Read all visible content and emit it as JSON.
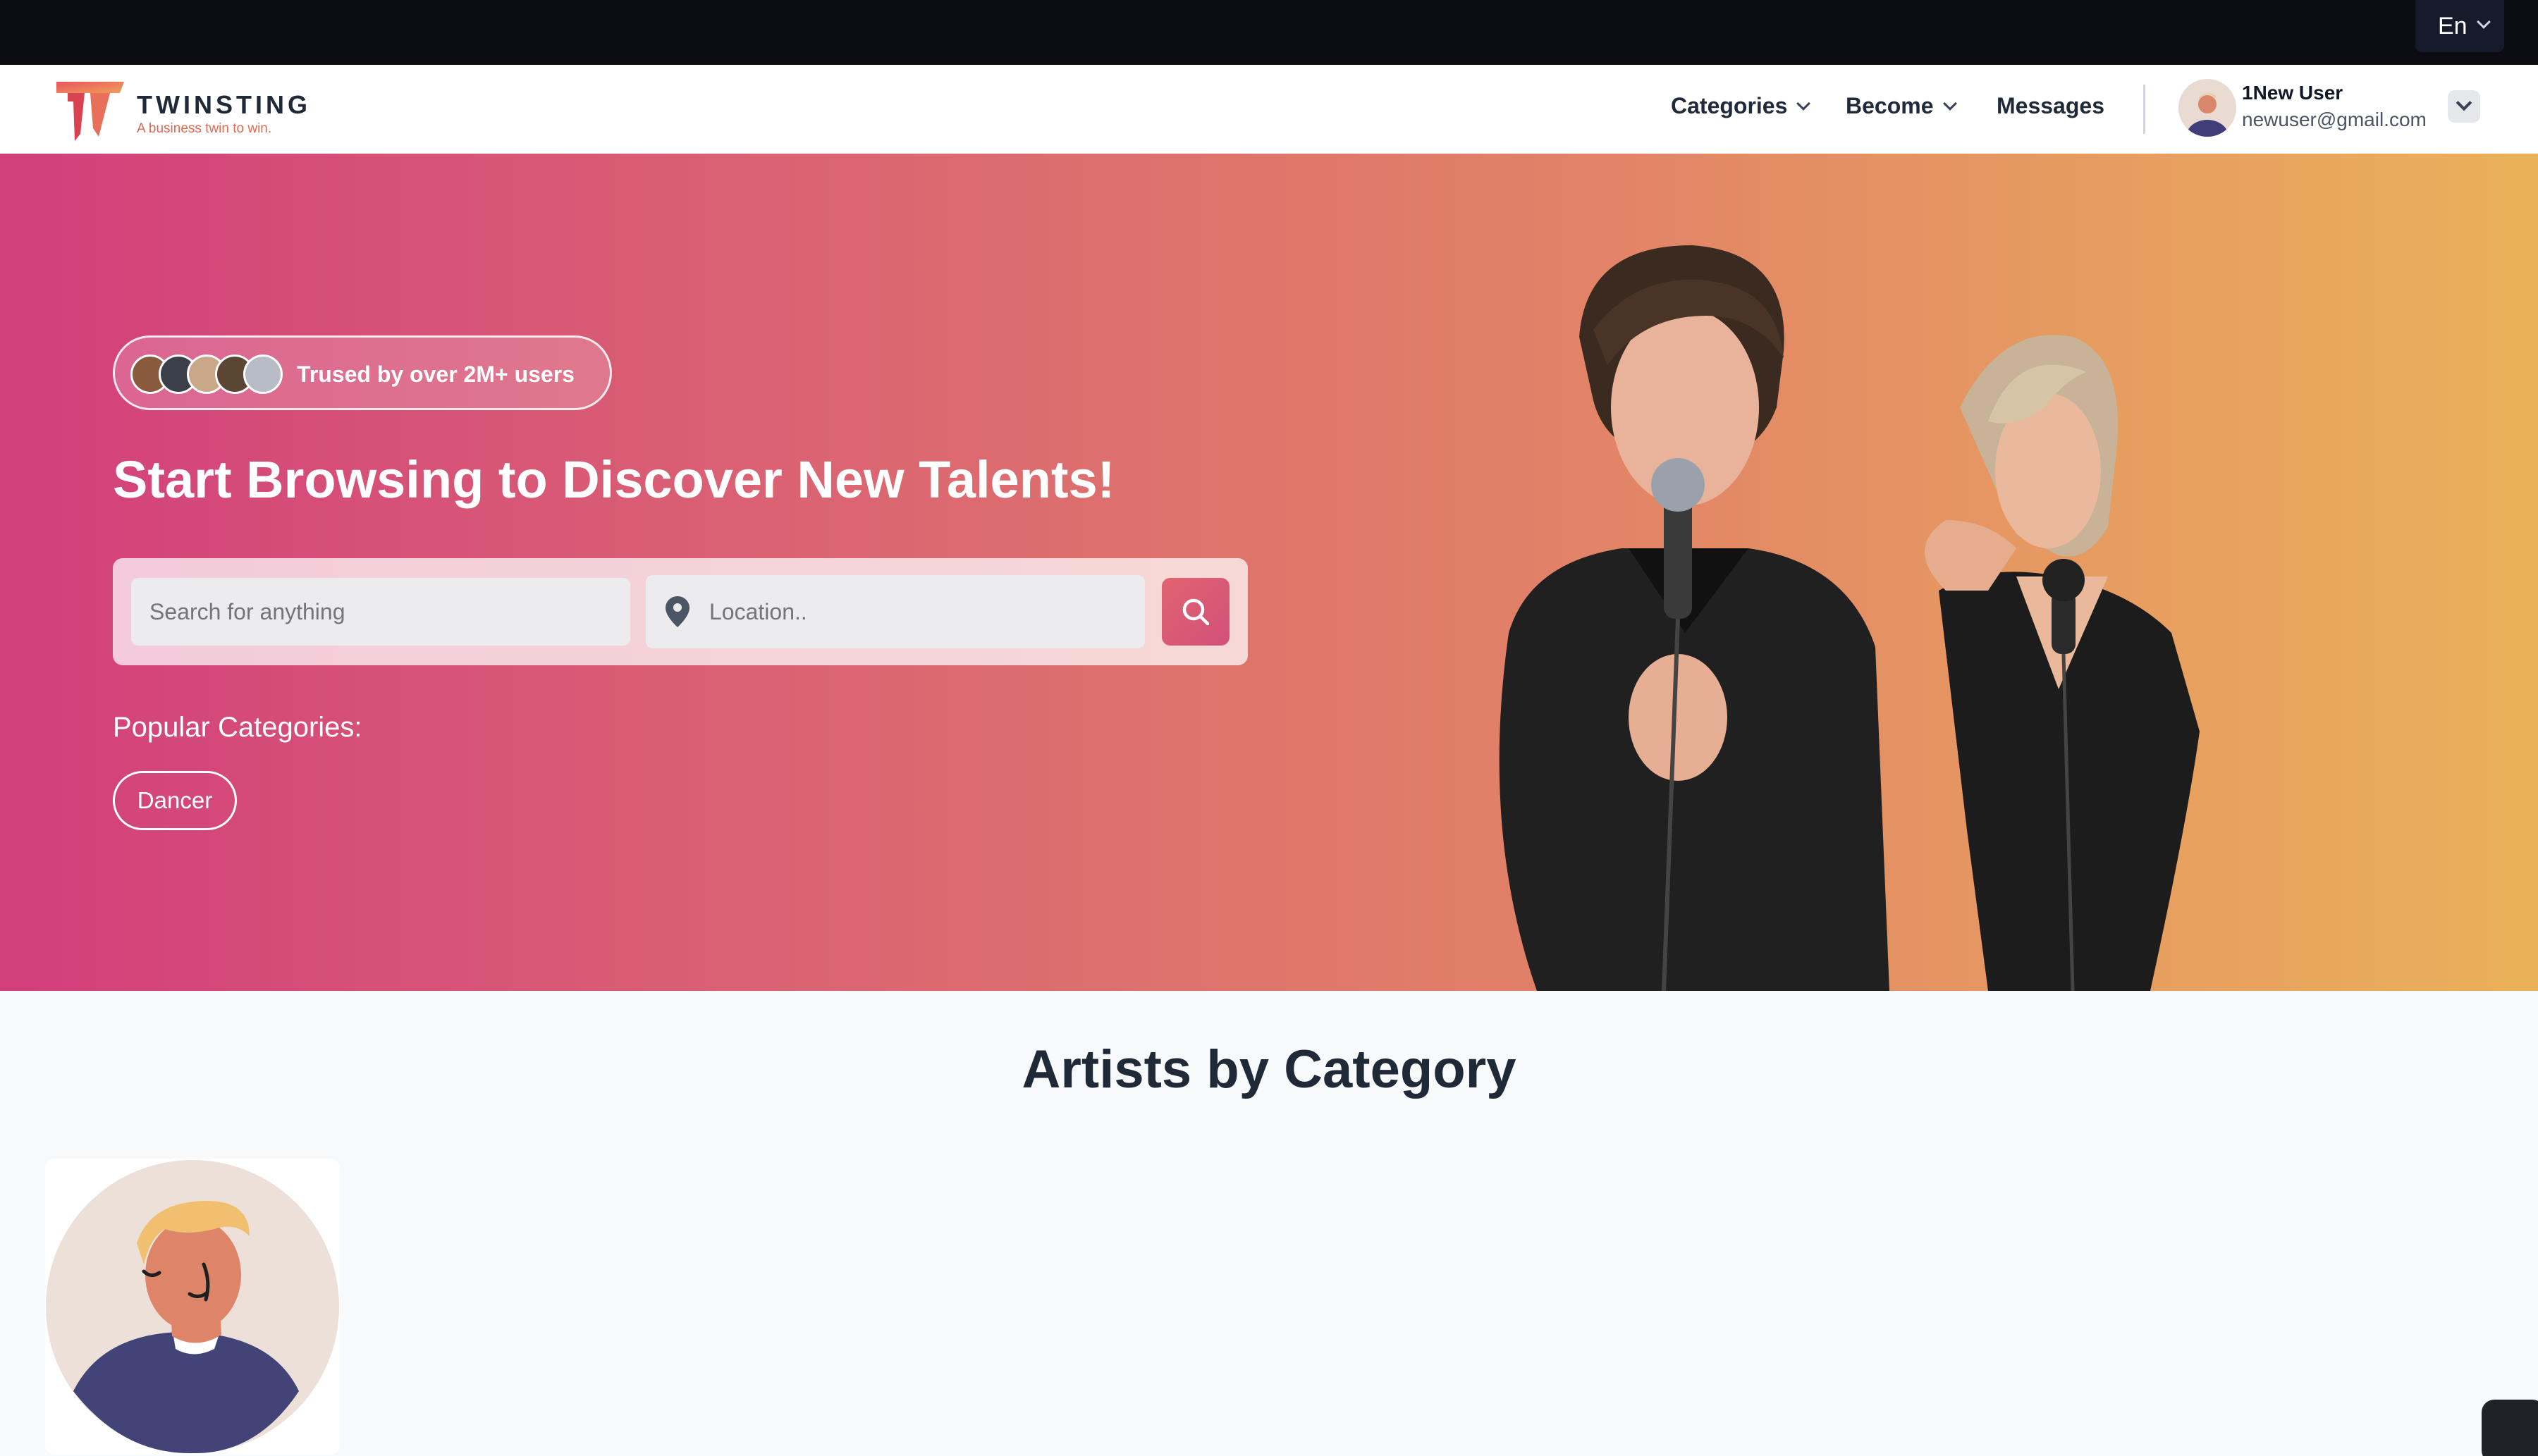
{
  "topbar": {
    "language": "En"
  },
  "navbar": {
    "brand_name": "TWINSTING",
    "brand_tagline": "A business twin to win.",
    "menu": {
      "categories": "Categories",
      "become": "Become",
      "messages": "Messages"
    },
    "user": {
      "name": "1New User",
      "email": "newuser@gmail.com"
    }
  },
  "hero": {
    "trust_text": "Trused by over 2M+ users",
    "title": "Start Browsing to Discover New Talents!",
    "search_placeholder": "Search for anything",
    "location_placeholder": "Location..",
    "popular_label": "Popular Categories:",
    "popular_categories": [
      "Dancer"
    ]
  },
  "section": {
    "title": "Artists by Category"
  },
  "colors": {
    "hero_start": "#d23f7b",
    "hero_end": "#ebb15a",
    "accent": "#e0646f",
    "dark": "#0c0d12"
  },
  "icons": [
    "chevron-down-icon",
    "location-pin-icon",
    "search-icon",
    "avatar-icon"
  ]
}
